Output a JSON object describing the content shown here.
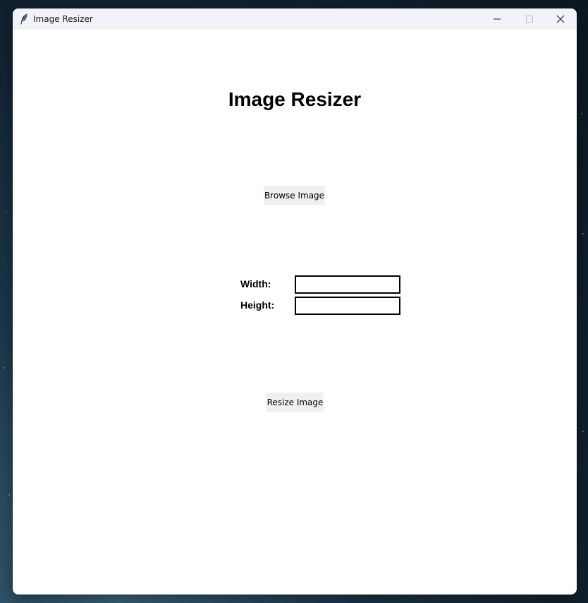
{
  "window": {
    "title": "Image Resizer",
    "app_icon": "feather-icon",
    "controls": {
      "minimize": "minimize-icon",
      "maximize": "maximize-icon",
      "close": "close-icon"
    }
  },
  "main": {
    "heading": "Image Resizer",
    "browse_button_label": "Browse Image",
    "width_label": "Width:",
    "width_value": "",
    "height_label": "Height:",
    "height_value": "",
    "resize_button_label": "Resize Image"
  },
  "colors": {
    "titlebar": "#f0f2f7",
    "window_background": "#ffffff",
    "button_background": "#f0f0f0",
    "entry_border": "#000000"
  }
}
